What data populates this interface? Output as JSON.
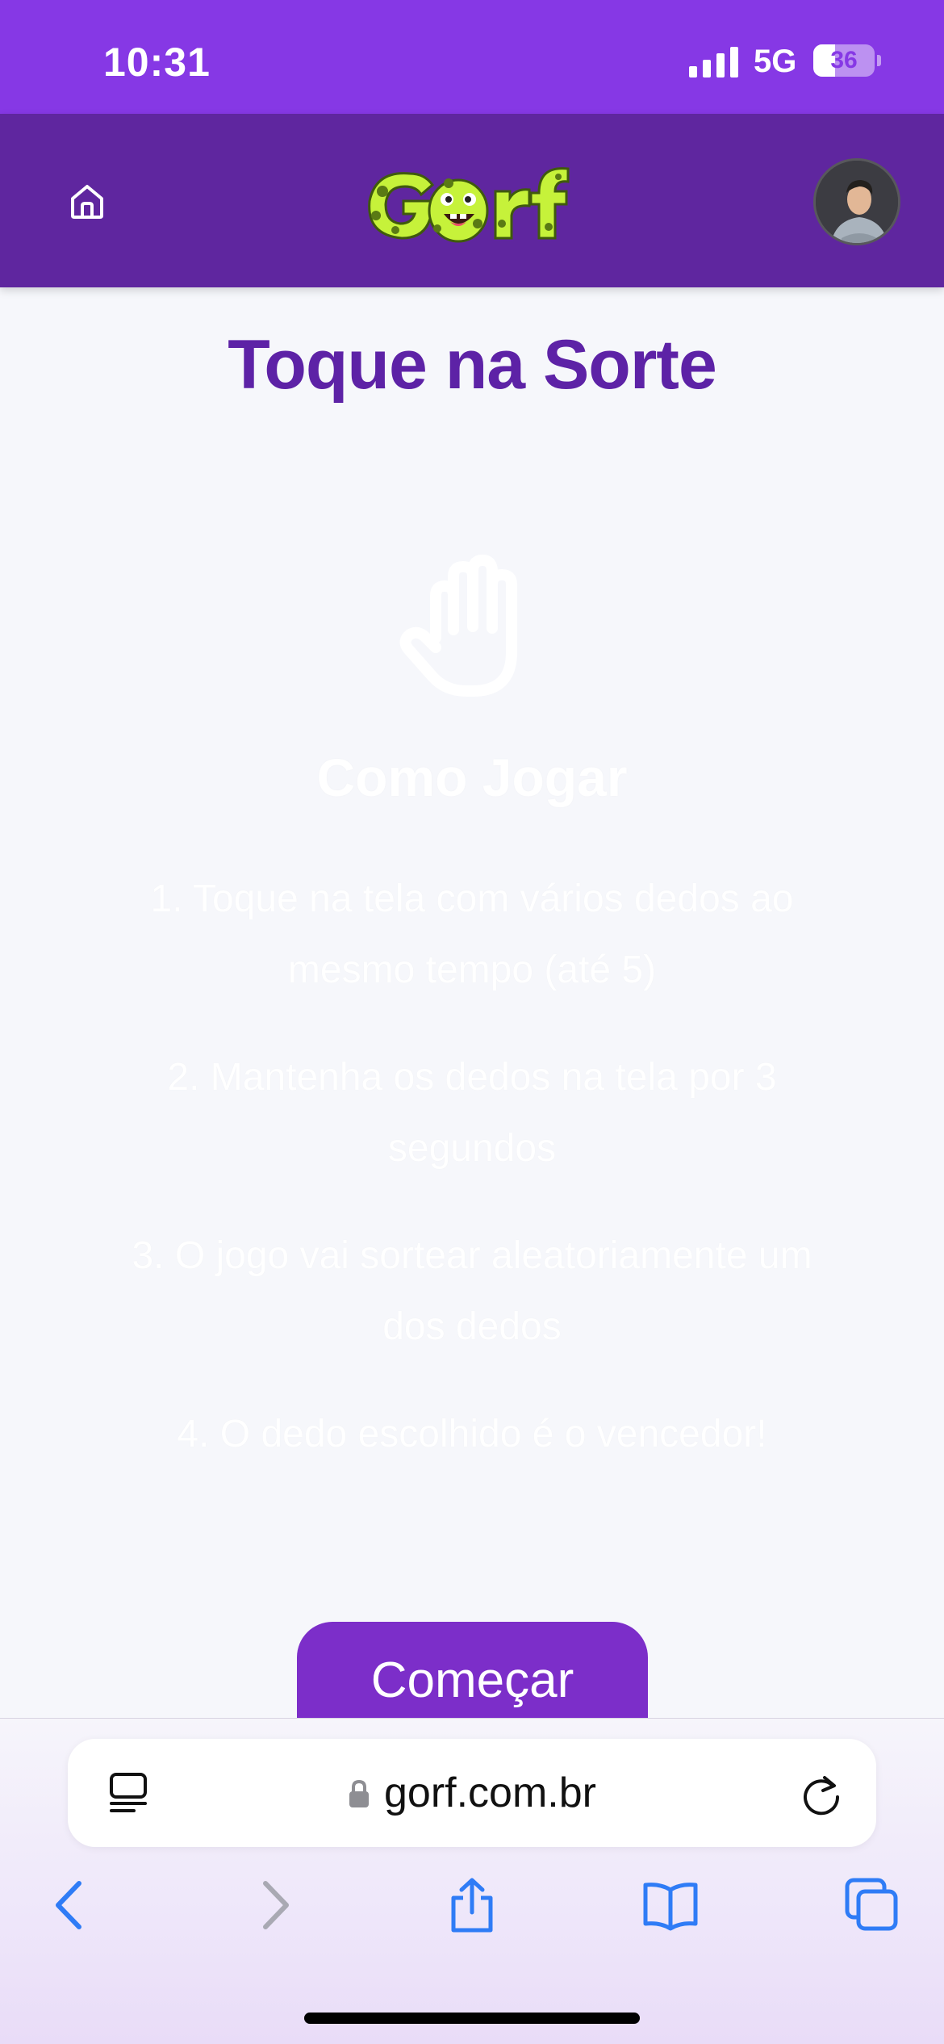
{
  "status_bar": {
    "time": "10:31",
    "network": "5G",
    "battery": "36",
    "battery_level": 0.36
  },
  "header": {
    "logo_text": "Gorf",
    "colors": {
      "header": "#5f269f",
      "status": "#8638e5",
      "logo": "#c6f23a"
    }
  },
  "page": {
    "title": "Toque na Sorte",
    "howto_title": "Como Jogar",
    "steps": [
      "1. Toque na tela com vários dedos ao mesmo tempo (até 5)",
      "2. Mantenha os dedos na tela por 3 segundos",
      "3. O jogo vai sortear aleatoriamente um dos dedos",
      "4. O dedo escolhido é o vencedor!"
    ],
    "start_label": "Começar"
  },
  "browser": {
    "url": "gorf.com.br",
    "icons": [
      "reader-icon",
      "lock-icon",
      "reload-icon",
      "back-icon",
      "forward-icon",
      "share-icon",
      "bookmarks-icon",
      "tabs-icon"
    ]
  }
}
